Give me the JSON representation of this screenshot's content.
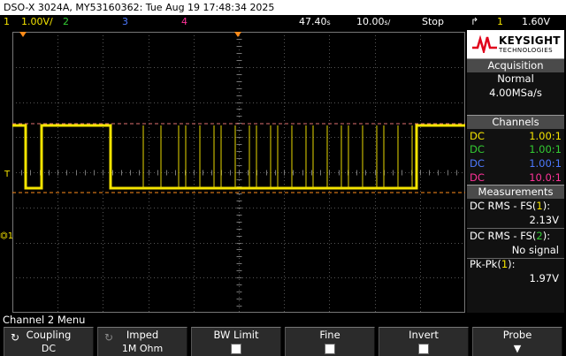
{
  "title_bar": {
    "text": "DSO-X 3024A, MY53160362: Tue Aug 19 17:48:34 2025"
  },
  "status_bar": {
    "ch1": {
      "num": "1",
      "scale": "1.00V/",
      "color": "#f5e400"
    },
    "ch2": {
      "num": "2",
      "color": "#33cc33"
    },
    "ch3": {
      "num": "3",
      "color": "#4d79ff"
    },
    "ch4": {
      "num": "4",
      "color": "#ff3399"
    },
    "time_offset": "47.40",
    "time_offset_unit": "s",
    "time_scale": "10.00",
    "time_scale_unit": "s/",
    "run_state": "Stop",
    "trigger_icon": "trigger-edge-icon",
    "trigger_channel": "1",
    "trigger_level": "1.60V"
  },
  "waveform": {
    "markers": {
      "left_trigger": "T",
      "left_ground": "1"
    }
  },
  "logo": {
    "brand": "KEYSIGHT",
    "sub": "TECHNOLOGIES"
  },
  "acquisition": {
    "title": "Acquisition",
    "mode": "Normal",
    "rate": "4.00MSa/s"
  },
  "channels": {
    "title": "Channels",
    "rows": [
      {
        "coupling": "DC",
        "ratio": "1.00:1",
        "color": "#f5e400"
      },
      {
        "coupling": "DC",
        "ratio": "1.00:1",
        "color": "#33cc33"
      },
      {
        "coupling": "DC",
        "ratio": "1.00:1",
        "color": "#4d79ff"
      },
      {
        "coupling": "DC",
        "ratio": "10.0:1",
        "color": "#ff3399"
      }
    ]
  },
  "measurements": {
    "title": "Measurements",
    "items": [
      {
        "label_pre": "DC RMS - FS(",
        "label_ch": "1",
        "label_post": "):",
        "value": "2.13V",
        "ch_color": "#f5e400"
      },
      {
        "label_pre": "DC RMS - FS(",
        "label_ch": "2",
        "label_post": "):",
        "value": "No signal",
        "ch_color": "#33cc33"
      },
      {
        "label_pre": "Pk-Pk(",
        "label_ch": "1",
        "label_post": "):",
        "value": "1.97V",
        "ch_color": "#f5e400"
      }
    ]
  },
  "menu": {
    "name": "Channel 2 Menu",
    "softkeys": [
      {
        "label": "Coupling",
        "value": "DC"
      },
      {
        "label": "Imped",
        "value": "1M Ohm"
      },
      {
        "label": "BW Limit",
        "value": ""
      },
      {
        "label": "Fine",
        "value": ""
      },
      {
        "label": "Invert",
        "value": ""
      },
      {
        "label": "Probe",
        "value": "▼"
      }
    ]
  },
  "colors": {
    "ch1": "#f5e400",
    "trigger_marker": "#ff8c1a",
    "grid": "#555555"
  }
}
